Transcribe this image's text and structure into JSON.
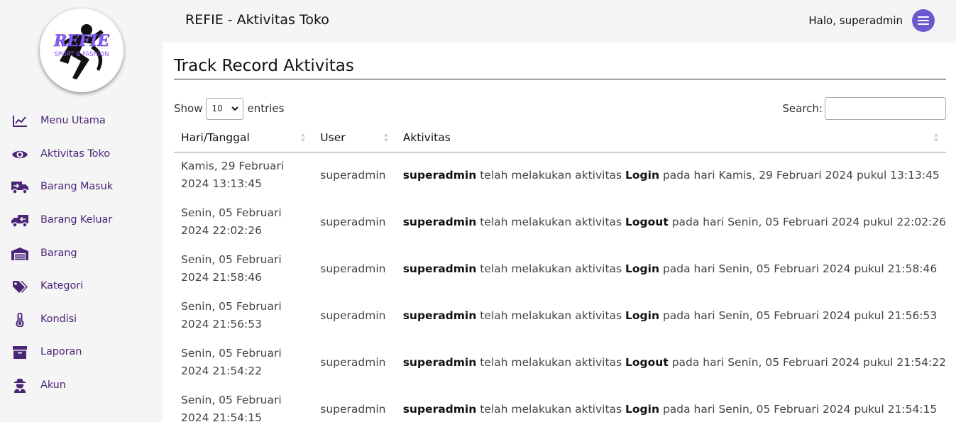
{
  "header": {
    "app_title": "REFIE - Aktivitas Toko",
    "greeting": "Halo, superadmin"
  },
  "logo": {
    "brand": "REFIE",
    "tagline": "SPORT & FASHION"
  },
  "sidebar": {
    "items": [
      {
        "label": "Menu Utama",
        "icon": "chart-line-icon"
      },
      {
        "label": "Aktivitas Toko",
        "icon": "eye-icon"
      },
      {
        "label": "Barang Masuk",
        "icon": "truck-icon"
      },
      {
        "label": "Barang Keluar",
        "icon": "truck-loading-icon"
      },
      {
        "label": "Barang",
        "icon": "warehouse-icon"
      },
      {
        "label": "Kategori",
        "icon": "tags-icon"
      },
      {
        "label": "Kondisi",
        "icon": "thermometer-icon"
      },
      {
        "label": "Laporan",
        "icon": "archive-icon"
      },
      {
        "label": "Akun",
        "icon": "user-secret-icon"
      }
    ]
  },
  "main": {
    "page_title": "Track Record Aktivitas",
    "length_menu": {
      "show": "Show",
      "value": "10",
      "entries": "entries"
    },
    "search_label": "Search:",
    "columns": [
      "Hari/Tanggal",
      "User",
      "Aktivitas"
    ],
    "rows": [
      {
        "date_line1": "Kamis, 29 Februari",
        "date_line2": "2024 13:13:45",
        "user": "superadmin",
        "actor": "superadmin",
        "mid": "telah melakukan aktivitas",
        "action": "Login",
        "tail": "pada hari Kamis, 29 Februari 2024 pukul 13:13:45"
      },
      {
        "date_line1": "Senin, 05 Februari",
        "date_line2": "2024 22:02:26",
        "user": "superadmin",
        "actor": "superadmin",
        "mid": "telah melakukan aktivitas",
        "action": "Logout",
        "tail": "pada hari Senin, 05 Februari 2024 pukul 22:02:26"
      },
      {
        "date_line1": "Senin, 05 Februari",
        "date_line2": "2024 21:58:46",
        "user": "superadmin",
        "actor": "superadmin",
        "mid": "telah melakukan aktivitas",
        "action": "Login",
        "tail": "pada hari Senin, 05 Februari 2024 pukul 21:58:46"
      },
      {
        "date_line1": "Senin, 05 Februari",
        "date_line2": "2024 21:56:53",
        "user": "superadmin",
        "actor": "superadmin",
        "mid": "telah melakukan aktivitas",
        "action": "Login",
        "tail": "pada hari Senin, 05 Februari 2024 pukul 21:56:53"
      },
      {
        "date_line1": "Senin, 05 Februari",
        "date_line2": "2024 21:54:22",
        "user": "superadmin",
        "actor": "superadmin",
        "mid": "telah melakukan aktivitas",
        "action": "Logout",
        "tail": "pada hari Senin, 05 Februari 2024 pukul 21:54:22"
      },
      {
        "date_line1": "Senin, 05 Februari",
        "date_line2": "2024 21:54:15",
        "user": "superadmin",
        "actor": "superadmin",
        "mid": "telah melakukan aktivitas",
        "action": "Login",
        "tail": "pada hari Senin, 05 Februari 2024 pukul 21:54:15"
      }
    ]
  },
  "colors": {
    "accent": "#6a5acd",
    "sidebar_text": "#4b2678",
    "logo_purple": "#8b5cf6"
  }
}
